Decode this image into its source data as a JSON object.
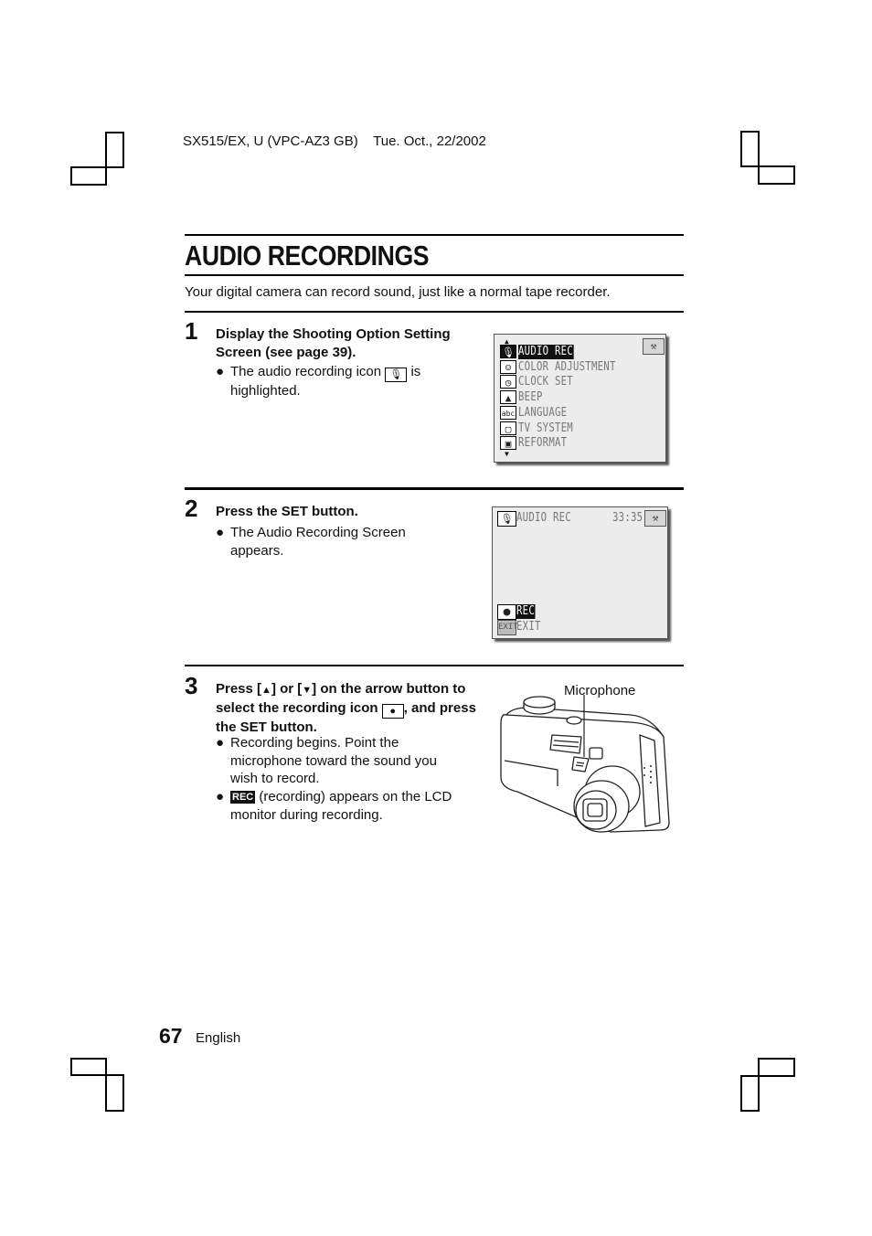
{
  "header": {
    "doc_id": "SX515/EX, U (VPC-AZ3 GB)",
    "date": "Tue. Oct., 22/2002"
  },
  "title": "AUDIO RECORDINGS",
  "intro": "Your digital camera can record sound, just like a normal tape recorder.",
  "steps": [
    {
      "number": "1",
      "heading": "Display the Shooting Option Setting Screen (see page 39).",
      "bullets": [
        {
          "before": "The audio recording icon",
          "icon": "microphone-icon",
          "after": "is highlighted."
        }
      ],
      "screen": {
        "items": [
          {
            "icon": "microphone-icon",
            "glyph": "🎙",
            "label": "AUDIO REC",
            "selected": true
          },
          {
            "icon": "palette-icon",
            "glyph": "☺",
            "label": "COLOR ADJUSTMENT",
            "selected": false
          },
          {
            "icon": "clock-icon",
            "glyph": "◷",
            "label": "CLOCK SET",
            "selected": false
          },
          {
            "icon": "bell-icon",
            "glyph": "▲",
            "label": "BEEP",
            "selected": false
          },
          {
            "icon": "language-icon",
            "glyph": "abc",
            "label": "LANGUAGE",
            "selected": false
          },
          {
            "icon": "tv-icon",
            "glyph": "▢",
            "label": "TV SYSTEM",
            "selected": false
          },
          {
            "icon": "card-icon",
            "glyph": "▣",
            "label": "REFORMAT",
            "selected": false
          }
        ],
        "scroll_up": "▲",
        "scroll_down": "▼",
        "tool_icon": "wrench-icon",
        "tool_glyph": "⚒"
      }
    },
    {
      "number": "2",
      "heading": "Press the SET button.",
      "bullets": [
        {
          "text": "The Audio Recording Screen appears."
        }
      ],
      "screen": {
        "mode_icon": "microphone-icon",
        "mode_glyph": "🎙",
        "mode_label": "AUDIO REC",
        "remaining_time": "33:35",
        "tool_glyph": "⚒",
        "rec_glyph": "●",
        "rec_label": "REC",
        "exit_glyph": "EXIT",
        "exit_label": "EXIT"
      }
    },
    {
      "number": "3",
      "heading_parts": {
        "p1": "Press [",
        "up": "▲",
        "p2": "] or [",
        "down": "▼",
        "p3": "] on the arrow button to select the recording icon",
        "icon_glyph": "●",
        "p4": ", and press the SET button."
      },
      "bullets": [
        {
          "text": "Recording begins. Point the microphone toward the sound you wish to record."
        },
        {
          "badge": "REC",
          "text": "(recording) appears on the LCD monitor during recording."
        }
      ],
      "figure": {
        "callout": "Microphone"
      }
    }
  ],
  "footer": {
    "page_number": "67",
    "language": "English"
  },
  "bullet_glyph": "●"
}
